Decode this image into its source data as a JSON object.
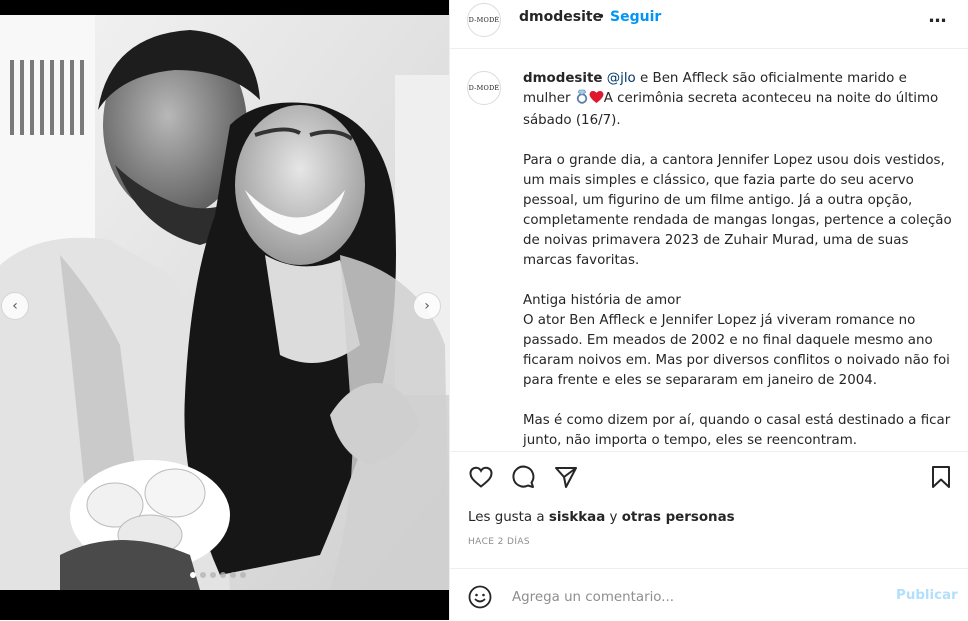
{
  "post": {
    "account": {
      "username": "dmodesite",
      "avatar_text": "D-MODÉ",
      "separator": "•",
      "follow_label": "Seguir"
    },
    "more_icon": "more-horizontal-icon",
    "caption": {
      "username": "dmodesite",
      "mention": "@jlo",
      "intro_text": " e Ben Affleck são oficialmente marido e mulher ",
      "emojis": [
        "ring-emoji",
        "red-heart-emoji"
      ],
      "intro_text_2": "A cerimônia secreta aconteceu na noite do último sábado (16/7).",
      "paragraph_2": "Para o grande dia, a cantora Jennifer Lopez usou dois vestidos, um mais simples e clássico, que fazia parte do seu acervo pessoal, um figurino de um filme antigo. Já a outra opção, completamente rendada de mangas longas, pertence a coleção de noivas primavera 2023 de Zuhair Murad, uma de suas marcas favoritas.",
      "subheading": "Antiga história de amor",
      "paragraph_3": "O ator Ben Affleck e Jennifer Lopez já viveram romance no passado. Em meados de 2002 e no final daquele mesmo ano ficaram noivos em. Mas por diversos conflitos o noivado não foi para frente e eles se separaram em janeiro de 2004.",
      "paragraph_4": "Mas é como dizem por aí, quando o casal está destinado a ficar junto, não importa o tempo, eles se reencontram."
    },
    "actions": {
      "icons": [
        "heart-icon",
        "comment-icon",
        "share-icon",
        "bookmark-icon"
      ]
    },
    "likes": {
      "prefix": "Les gusta a ",
      "user": "siskkaa",
      "middle": " y ",
      "others": "otras personas"
    },
    "timestamp": "HACE 2 DÍAS",
    "comment": {
      "placeholder": "Agrega un comentario...",
      "publish_label": "Publicar"
    },
    "carousel": {
      "slide_count": 6,
      "active_index": 0
    },
    "colors": {
      "link_blue": "#0095f6",
      "mention_blue": "#00376b",
      "publish_disabled": "#b2dffc",
      "border": "#efefef",
      "muted": "#8e8e8e"
    }
  }
}
